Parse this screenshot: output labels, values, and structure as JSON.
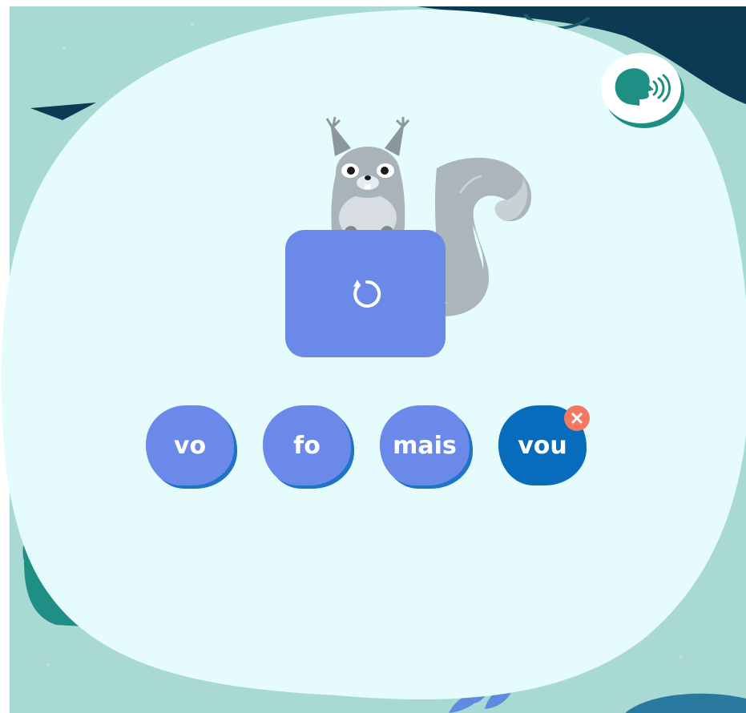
{
  "colors": {
    "background": "#a9d9d3",
    "bubble": "#e6fbfb",
    "dark_navy": "#0b3b52",
    "teal": "#1f8f86",
    "button": "#6b89e8",
    "button_shadow": "#1f74c9",
    "selected_button": "#086cbc",
    "wrong_badge": "#f27a62",
    "squirrel_grey": "#a9b4ba"
  },
  "icons": {
    "speech": "speaking-head-icon",
    "replay": "replay-icon",
    "wrong": "close-icon"
  },
  "game": {
    "choices": [
      {
        "label": "vo",
        "state": "default"
      },
      {
        "label": "fo",
        "state": "default"
      },
      {
        "label": "mais",
        "state": "default"
      },
      {
        "label": "vou",
        "state": "wrong"
      }
    ]
  }
}
